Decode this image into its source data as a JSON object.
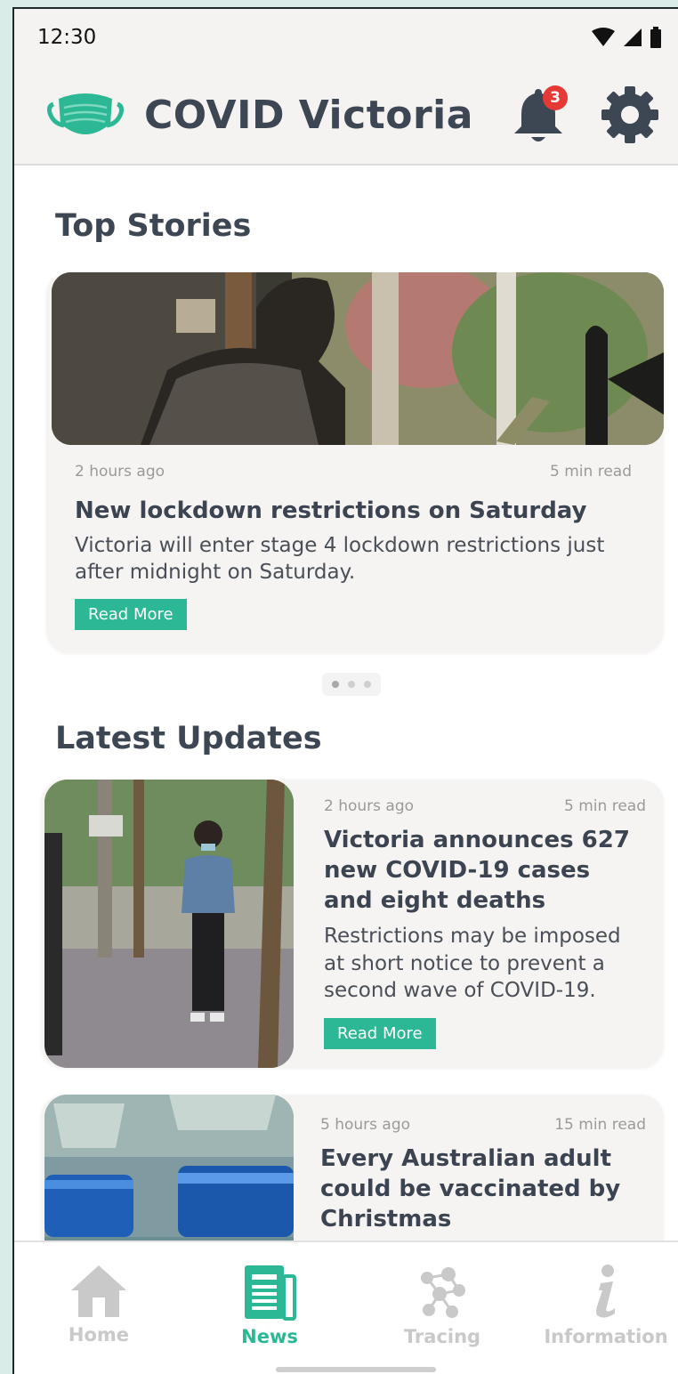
{
  "status_bar": {
    "time": "12:30"
  },
  "app_bar": {
    "title": "COVID Victoria",
    "notification_count": "3",
    "icons": [
      "mask-logo-icon",
      "bell-icon",
      "gear-icon"
    ]
  },
  "top_stories": {
    "title": "Top Stories",
    "card": {
      "time_ago": "2 hours ago",
      "read_time": "5 min read",
      "headline": "New lockdown restrictions on Saturday",
      "excerpt": "Victoria will enter stage 4 lockdown restrictions just after midnight on Saturday.",
      "button": "Read More"
    },
    "carousel": {
      "count": 3,
      "active_index": 0
    }
  },
  "latest_updates": {
    "title": "Latest Updates",
    "items": [
      {
        "time_ago": "2 hours ago",
        "read_time": "5 min read",
        "headline": "Victoria announces 627 new COVID-19 cases and eight deaths",
        "excerpt": "Restrictions may be imposed at short notice to prevent a second wave of COVID-19.",
        "button": "Read More"
      },
      {
        "time_ago": "5 hours ago",
        "read_time": "15 min read",
        "headline": "Every Australian adult could be vaccinated by Christmas"
      }
    ]
  },
  "bottom_nav": {
    "items": [
      {
        "label": "Home",
        "icon": "home-icon",
        "active": false
      },
      {
        "label": "News",
        "icon": "news-icon",
        "active": true
      },
      {
        "label": "Tracing",
        "icon": "tracing-icon",
        "active": false
      },
      {
        "label": "Information",
        "icon": "info-icon",
        "active": false
      }
    ]
  },
  "colors": {
    "accent": "#2cb894",
    "title_text": "#3d4653",
    "badge": "#e53935",
    "app_bar_bg": "#f5f3f2"
  }
}
